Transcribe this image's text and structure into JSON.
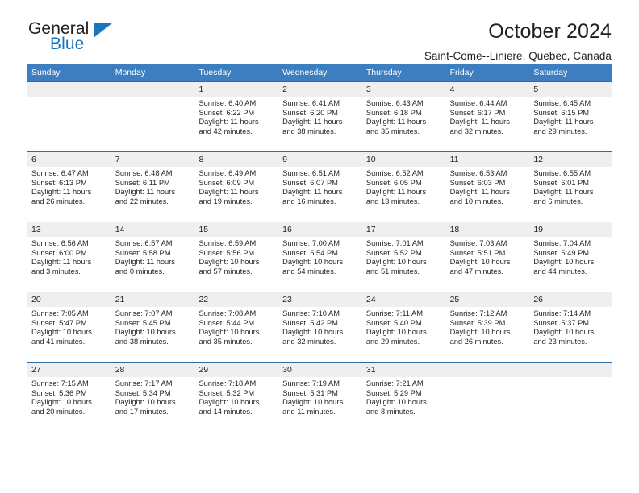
{
  "logo": {
    "word1": "General",
    "word2": "Blue",
    "triangle_color": "#1b75bb",
    "icon": "general-blue-logo"
  },
  "header": {
    "title": "October 2024",
    "subtitle": "Saint-Come--Liniere, Quebec, Canada"
  },
  "theme": {
    "header_blue": "#3c7ebf",
    "rule_blue": "#2e6da4",
    "daynum_band": "#efefef",
    "text": "#231f20"
  },
  "calendar": {
    "weekdays": [
      "Sunday",
      "Monday",
      "Tuesday",
      "Wednesday",
      "Thursday",
      "Friday",
      "Saturday"
    ],
    "weeks": [
      [
        {
          "day": "",
          "sunrise": "",
          "sunset": "",
          "daylight1": "",
          "daylight2": ""
        },
        {
          "day": "",
          "sunrise": "",
          "sunset": "",
          "daylight1": "",
          "daylight2": ""
        },
        {
          "day": "1",
          "sunrise": "Sunrise: 6:40 AM",
          "sunset": "Sunset: 6:22 PM",
          "daylight1": "Daylight: 11 hours",
          "daylight2": "and 42 minutes."
        },
        {
          "day": "2",
          "sunrise": "Sunrise: 6:41 AM",
          "sunset": "Sunset: 6:20 PM",
          "daylight1": "Daylight: 11 hours",
          "daylight2": "and 38 minutes."
        },
        {
          "day": "3",
          "sunrise": "Sunrise: 6:43 AM",
          "sunset": "Sunset: 6:18 PM",
          "daylight1": "Daylight: 11 hours",
          "daylight2": "and 35 minutes."
        },
        {
          "day": "4",
          "sunrise": "Sunrise: 6:44 AM",
          "sunset": "Sunset: 6:17 PM",
          "daylight1": "Daylight: 11 hours",
          "daylight2": "and 32 minutes."
        },
        {
          "day": "5",
          "sunrise": "Sunrise: 6:45 AM",
          "sunset": "Sunset: 6:15 PM",
          "daylight1": "Daylight: 11 hours",
          "daylight2": "and 29 minutes."
        }
      ],
      [
        {
          "day": "6",
          "sunrise": "Sunrise: 6:47 AM",
          "sunset": "Sunset: 6:13 PM",
          "daylight1": "Daylight: 11 hours",
          "daylight2": "and 26 minutes."
        },
        {
          "day": "7",
          "sunrise": "Sunrise: 6:48 AM",
          "sunset": "Sunset: 6:11 PM",
          "daylight1": "Daylight: 11 hours",
          "daylight2": "and 22 minutes."
        },
        {
          "day": "8",
          "sunrise": "Sunrise: 6:49 AM",
          "sunset": "Sunset: 6:09 PM",
          "daylight1": "Daylight: 11 hours",
          "daylight2": "and 19 minutes."
        },
        {
          "day": "9",
          "sunrise": "Sunrise: 6:51 AM",
          "sunset": "Sunset: 6:07 PM",
          "daylight1": "Daylight: 11 hours",
          "daylight2": "and 16 minutes."
        },
        {
          "day": "10",
          "sunrise": "Sunrise: 6:52 AM",
          "sunset": "Sunset: 6:05 PM",
          "daylight1": "Daylight: 11 hours",
          "daylight2": "and 13 minutes."
        },
        {
          "day": "11",
          "sunrise": "Sunrise: 6:53 AM",
          "sunset": "Sunset: 6:03 PM",
          "daylight1": "Daylight: 11 hours",
          "daylight2": "and 10 minutes."
        },
        {
          "day": "12",
          "sunrise": "Sunrise: 6:55 AM",
          "sunset": "Sunset: 6:01 PM",
          "daylight1": "Daylight: 11 hours",
          "daylight2": "and 6 minutes."
        }
      ],
      [
        {
          "day": "13",
          "sunrise": "Sunrise: 6:56 AM",
          "sunset": "Sunset: 6:00 PM",
          "daylight1": "Daylight: 11 hours",
          "daylight2": "and 3 minutes."
        },
        {
          "day": "14",
          "sunrise": "Sunrise: 6:57 AM",
          "sunset": "Sunset: 5:58 PM",
          "daylight1": "Daylight: 11 hours",
          "daylight2": "and 0 minutes."
        },
        {
          "day": "15",
          "sunrise": "Sunrise: 6:59 AM",
          "sunset": "Sunset: 5:56 PM",
          "daylight1": "Daylight: 10 hours",
          "daylight2": "and 57 minutes."
        },
        {
          "day": "16",
          "sunrise": "Sunrise: 7:00 AM",
          "sunset": "Sunset: 5:54 PM",
          "daylight1": "Daylight: 10 hours",
          "daylight2": "and 54 minutes."
        },
        {
          "day": "17",
          "sunrise": "Sunrise: 7:01 AM",
          "sunset": "Sunset: 5:52 PM",
          "daylight1": "Daylight: 10 hours",
          "daylight2": "and 51 minutes."
        },
        {
          "day": "18",
          "sunrise": "Sunrise: 7:03 AM",
          "sunset": "Sunset: 5:51 PM",
          "daylight1": "Daylight: 10 hours",
          "daylight2": "and 47 minutes."
        },
        {
          "day": "19",
          "sunrise": "Sunrise: 7:04 AM",
          "sunset": "Sunset: 5:49 PM",
          "daylight1": "Daylight: 10 hours",
          "daylight2": "and 44 minutes."
        }
      ],
      [
        {
          "day": "20",
          "sunrise": "Sunrise: 7:05 AM",
          "sunset": "Sunset: 5:47 PM",
          "daylight1": "Daylight: 10 hours",
          "daylight2": "and 41 minutes."
        },
        {
          "day": "21",
          "sunrise": "Sunrise: 7:07 AM",
          "sunset": "Sunset: 5:45 PM",
          "daylight1": "Daylight: 10 hours",
          "daylight2": "and 38 minutes."
        },
        {
          "day": "22",
          "sunrise": "Sunrise: 7:08 AM",
          "sunset": "Sunset: 5:44 PM",
          "daylight1": "Daylight: 10 hours",
          "daylight2": "and 35 minutes."
        },
        {
          "day": "23",
          "sunrise": "Sunrise: 7:10 AM",
          "sunset": "Sunset: 5:42 PM",
          "daylight1": "Daylight: 10 hours",
          "daylight2": "and 32 minutes."
        },
        {
          "day": "24",
          "sunrise": "Sunrise: 7:11 AM",
          "sunset": "Sunset: 5:40 PM",
          "daylight1": "Daylight: 10 hours",
          "daylight2": "and 29 minutes."
        },
        {
          "day": "25",
          "sunrise": "Sunrise: 7:12 AM",
          "sunset": "Sunset: 5:39 PM",
          "daylight1": "Daylight: 10 hours",
          "daylight2": "and 26 minutes."
        },
        {
          "day": "26",
          "sunrise": "Sunrise: 7:14 AM",
          "sunset": "Sunset: 5:37 PM",
          "daylight1": "Daylight: 10 hours",
          "daylight2": "and 23 minutes."
        }
      ],
      [
        {
          "day": "27",
          "sunrise": "Sunrise: 7:15 AM",
          "sunset": "Sunset: 5:36 PM",
          "daylight1": "Daylight: 10 hours",
          "daylight2": "and 20 minutes."
        },
        {
          "day": "28",
          "sunrise": "Sunrise: 7:17 AM",
          "sunset": "Sunset: 5:34 PM",
          "daylight1": "Daylight: 10 hours",
          "daylight2": "and 17 minutes."
        },
        {
          "day": "29",
          "sunrise": "Sunrise: 7:18 AM",
          "sunset": "Sunset: 5:32 PM",
          "daylight1": "Daylight: 10 hours",
          "daylight2": "and 14 minutes."
        },
        {
          "day": "30",
          "sunrise": "Sunrise: 7:19 AM",
          "sunset": "Sunset: 5:31 PM",
          "daylight1": "Daylight: 10 hours",
          "daylight2": "and 11 minutes."
        },
        {
          "day": "31",
          "sunrise": "Sunrise: 7:21 AM",
          "sunset": "Sunset: 5:29 PM",
          "daylight1": "Daylight: 10 hours",
          "daylight2": "and 8 minutes."
        },
        {
          "day": "",
          "sunrise": "",
          "sunset": "",
          "daylight1": "",
          "daylight2": ""
        },
        {
          "day": "",
          "sunrise": "",
          "sunset": "",
          "daylight1": "",
          "daylight2": ""
        }
      ]
    ]
  }
}
